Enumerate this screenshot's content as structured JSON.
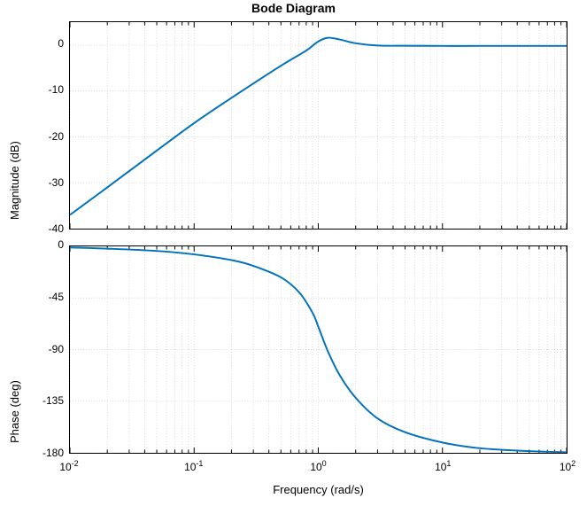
{
  "title": "Bode Diagram",
  "xlabel": "Frequency  (rad/s)",
  "mag": {
    "ylabel": "Magnitude (dB)",
    "yticks": [
      -40,
      -30,
      -20,
      -10,
      0
    ],
    "ymin": -40,
    "ymax": 5
  },
  "phase": {
    "ylabel": "Phase (deg)",
    "yticks": [
      -180,
      -135,
      -90,
      -45,
      0
    ],
    "ymin": -180,
    "ymax": 0
  },
  "xticks": [
    "10^{-2}",
    "10^{-1}",
    "10^{0}",
    "10^{1}",
    "10^{2}"
  ],
  "xexp_min": -2,
  "xexp_max": 2,
  "chart_data": [
    {
      "type": "line",
      "title": "Magnitude",
      "xlabel": "Frequency (rad/s)",
      "ylabel": "Magnitude (dB)",
      "xscale": "log",
      "ylim": [
        -40,
        5
      ],
      "xlim": [
        0.01,
        100
      ],
      "series": [
        {
          "name": "Magnitude",
          "x": [
            0.01,
            0.02,
            0.05,
            0.1,
            0.2,
            0.5,
            0.8,
            1.0,
            1.2,
            1.5,
            2.0,
            3.0,
            5.0,
            10,
            20,
            50,
            100
          ],
          "values": [
            -37,
            -31,
            -23,
            -17,
            -11.5,
            -4.5,
            -1.2,
            0.8,
            1.6,
            1.2,
            0.4,
            -0.1,
            -0.15,
            -0.18,
            -0.18,
            -0.18,
            -0.18
          ]
        }
      ]
    },
    {
      "type": "line",
      "title": "Phase",
      "xlabel": "Frequency (rad/s)",
      "ylabel": "Phase (deg)",
      "xscale": "log",
      "ylim": [
        -180,
        0
      ],
      "xlim": [
        0.01,
        100
      ],
      "series": [
        {
          "name": "Phase",
          "x": [
            0.01,
            0.02,
            0.05,
            0.1,
            0.2,
            0.3,
            0.5,
            0.7,
            0.9,
            1.0,
            1.2,
            1.5,
            2.0,
            3.0,
            5.0,
            10,
            20,
            50,
            100
          ],
          "values": [
            -1,
            -2,
            -4,
            -7,
            -12,
            -17,
            -27,
            -40,
            -58,
            -70,
            -92,
            -113,
            -132,
            -150,
            -162,
            -171,
            -176,
            -178.5,
            -179.5
          ]
        }
      ]
    }
  ]
}
